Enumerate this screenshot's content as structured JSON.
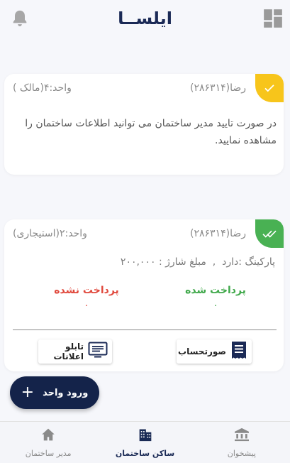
{
  "header": {
    "brand": "ایلســا",
    "left_icon": "bell-icon",
    "right_icon": "dashboard-grid-icon"
  },
  "cards": [
    {
      "status": "approved-single",
      "status_icon": "check-icon",
      "status_color": "#f7c51b",
      "name": "رضا(۲۸۶۳۱۴)",
      "unit": "واحد:۴(مالک )",
      "message": "در صورت تایید مدیر ساختمان می توانید اطلاعات ساختمان را مشاهده نمایید."
    },
    {
      "status": "approved-double",
      "status_icon": "double-check-icon",
      "status_color": "#49b153",
      "name": "رضا(۲۸۶۳۱۴)",
      "unit": "واحد:۲(استیجاری)",
      "details": "پارکینگ :دارد  ,  مبلغ شارژ : ۲۰۰,۰۰۰",
      "paid_label": "پرداخت شده",
      "paid_count": "۰",
      "unpaid_label": "پرداخت نشده",
      "unpaid_count": "۰",
      "invoices_button": "صورتحساب",
      "board_button": "تابلو اعلانات"
    }
  ],
  "fab": {
    "label": "ورود واحد",
    "icon": "plus-icon"
  },
  "bottom_nav": {
    "items": [
      {
        "label": "پیشخوان",
        "icon": "bank-icon",
        "active": false
      },
      {
        "label": "ساکن ساختمان",
        "icon": "buildings-icon",
        "active": true
      },
      {
        "label": "مدیر ساختمان",
        "icon": "home-icon",
        "active": false
      }
    ]
  },
  "colors": {
    "primary": "#14234a",
    "paid": "#3fa84a",
    "unpaid": "#e0483c",
    "background": "#f6f7fb"
  }
}
